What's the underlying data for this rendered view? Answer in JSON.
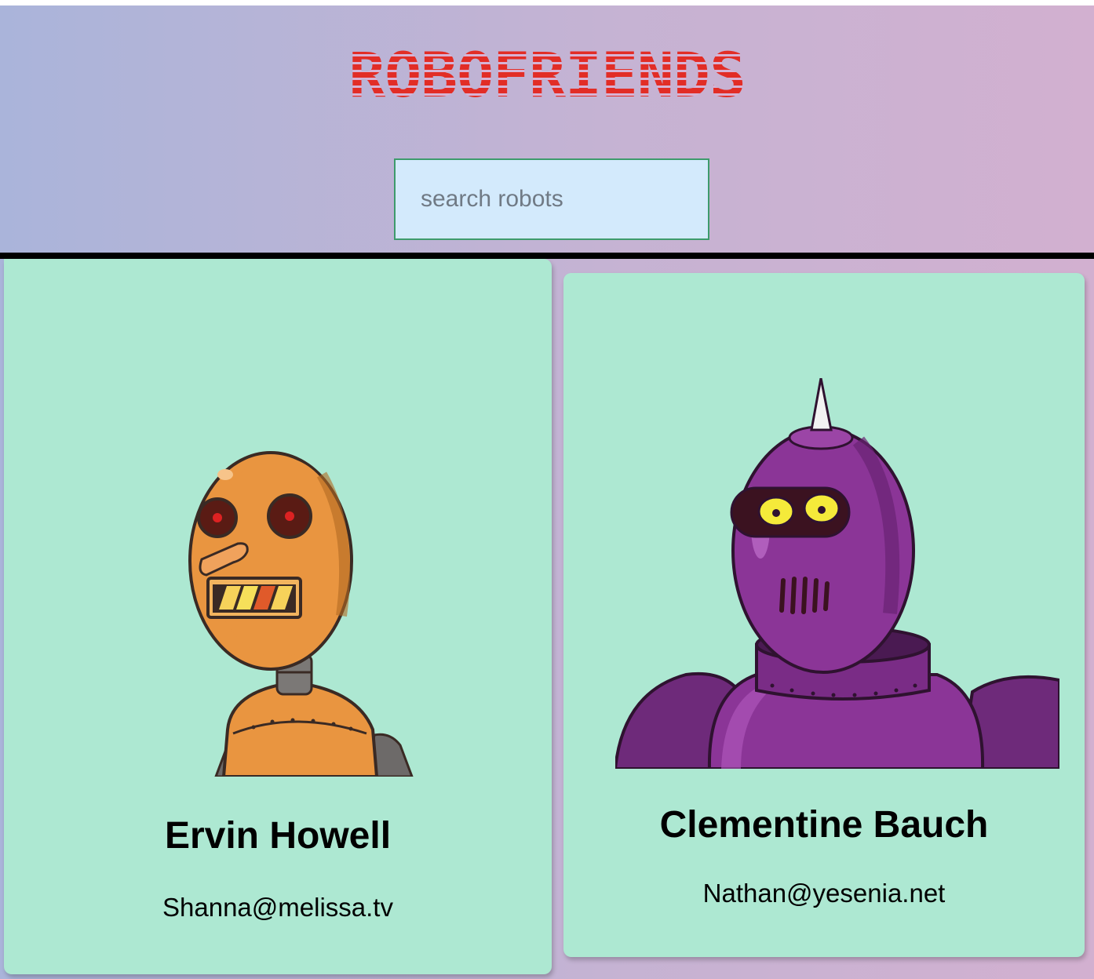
{
  "app": {
    "title": "ROBOFRIENDS"
  },
  "search": {
    "placeholder": "search robots",
    "value": ""
  },
  "colors": {
    "title": "#e22d26",
    "card_background": "#ade8d2",
    "search_background": "#d3eafc",
    "search_border": "#3d9b6c"
  },
  "robots": [
    {
      "name": "Ervin Howell",
      "email": "Shanna@melissa.tv",
      "avatar_icon": "orange-robot-avatar"
    },
    {
      "name": "Clementine Bauch",
      "email": "Nathan@yesenia.net",
      "avatar_icon": "purple-robot-avatar"
    }
  ]
}
